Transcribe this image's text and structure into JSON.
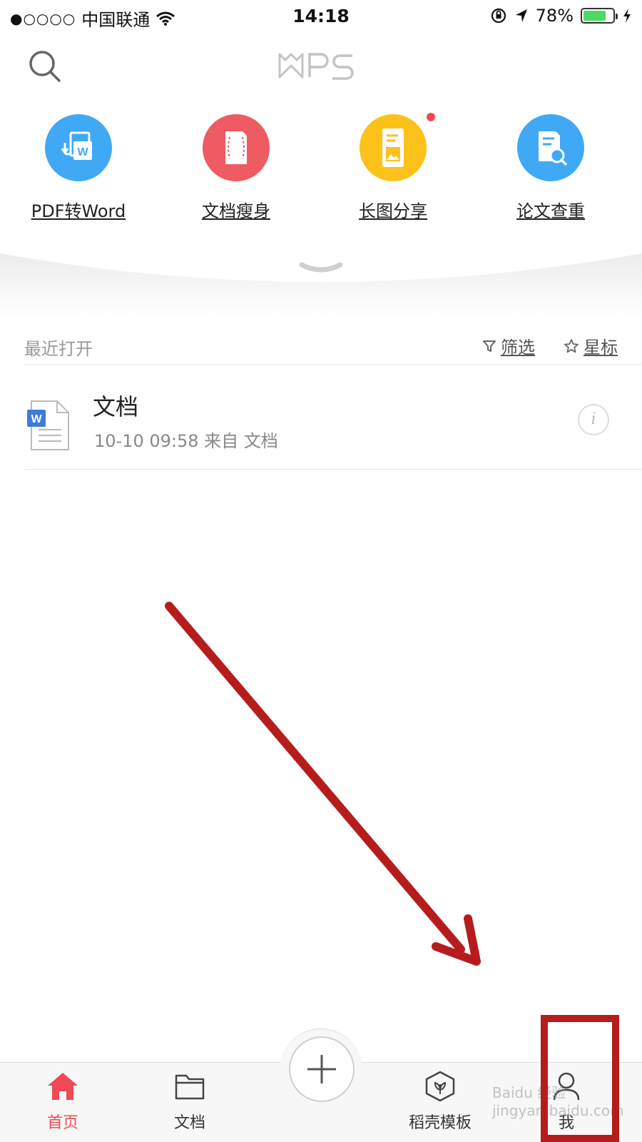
{
  "status_bar": {
    "signal": "●○○○○",
    "carrier": "中国联通",
    "time": "14:18",
    "battery": "78%",
    "battery_level": 0.78
  },
  "header": {
    "logo": "WPS",
    "search_icon": "search-icon"
  },
  "tools": [
    {
      "label": "PDF转Word",
      "color": "#3fa9f5",
      "icon": "pdf-to-word-icon"
    },
    {
      "label": "文档瘦身",
      "color": "#ef5b62",
      "icon": "slim-document-icon"
    },
    {
      "label": "长图分享",
      "color": "#fdc21a",
      "icon": "long-image-share-icon",
      "badge": true
    },
    {
      "label": "论文查重",
      "color": "#3fa9f5",
      "icon": "paper-check-icon"
    }
  ],
  "recent": {
    "title": "最近打开",
    "filter_label": "筛选",
    "star_label": "星标",
    "files": [
      {
        "name": "文档",
        "meta": "10-10 09:58  来自 文档",
        "icon": "word-document-icon"
      }
    ]
  },
  "tabbar": {
    "home": "首页",
    "docs": "文档",
    "templates": "稻壳模板",
    "me": "我"
  },
  "colors": {
    "accent": "#ef4a55",
    "annotation": "#b71c1c"
  },
  "watermark": "Baidu 经验 jingyan.baidu.com"
}
